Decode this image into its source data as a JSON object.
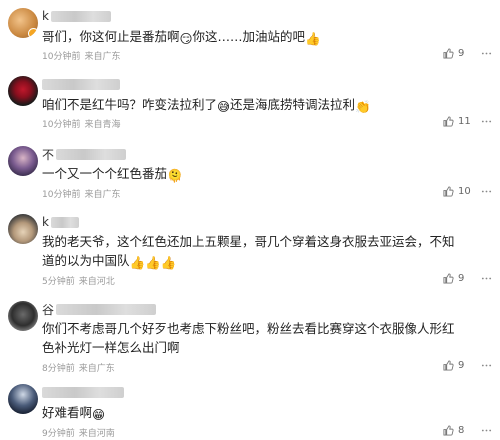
{
  "comments": [
    {
      "name_initial": "k",
      "text": "哥们，你这何止是番茄啊",
      "text_tail": "你这……加油站的吧",
      "emoji_mid": "smirk-emoji",
      "emoji_end": "thumbs-up-emoji",
      "time": "10分钟前",
      "location": "来自广东",
      "likes": "9",
      "avatar": "orange-cat-avatar"
    },
    {
      "name_initial": "",
      "text": "咱们不是红牛吗？咋变法拉利了",
      "text_mid": "还是海底捞特调法拉利",
      "emoji_mid": "sweat-smile-emoji",
      "emoji_end": "clap-emoji",
      "time": "10分钟前",
      "location": "来自青海",
      "likes": "11",
      "avatar": "red-rose-avatar"
    },
    {
      "name_initial": "不",
      "text": "一个又一个个红色番茄",
      "emoji_end": "melting-emoji",
      "time": "10分钟前",
      "location": "来自广东",
      "likes": "10",
      "avatar": "purple-portrait-avatar"
    },
    {
      "name_initial": "k",
      "text_line1": "我的老天爷，这个红色还加上五颗星，哥几个穿着这身衣服去亚运会，不知",
      "text_line2": "道的以为中国队",
      "emoji_end": "thumbs-up-emoji",
      "time": "5分钟前",
      "location": "来自河北",
      "likes": "9",
      "avatar": "sunglasses-avatar"
    },
    {
      "name_initial": "谷",
      "text_line1": "你们不考虑哥几个好歹也考虑下粉丝吧，粉丝去看比赛穿这个衣服像人形红",
      "text_line2": "色补光灯一样怎么出门啊",
      "time": "8分钟前",
      "location": "来自广东",
      "likes": "9",
      "avatar": "dark-figure-avatar"
    },
    {
      "name_initial": "",
      "text": "好难看啊",
      "emoji_end": "grin-emoji",
      "time": "9分钟前",
      "location": "来自河南",
      "likes": "8",
      "avatar": "night-sky-avatar"
    }
  ]
}
